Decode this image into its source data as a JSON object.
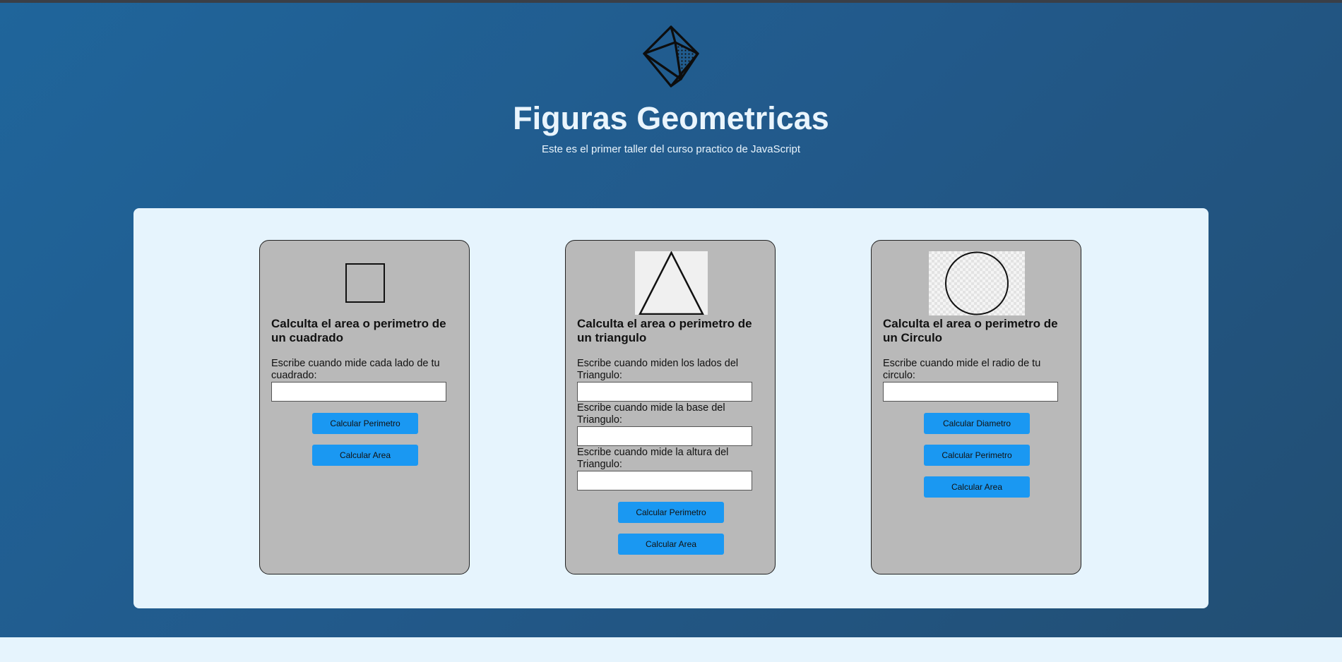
{
  "header": {
    "title": "Figuras Geometricas",
    "subtitle": "Este es el primer taller del curso practico de JavaScript",
    "icon": "octahedron-icon"
  },
  "colors": {
    "hero_gradient_start": "#1f659b",
    "hero_gradient_end": "#224e73",
    "panel_bg": "#e6f4fd",
    "card_bg": "#b9b9b9",
    "button_bg": "#1a98f2"
  },
  "cards": {
    "square": {
      "icon": "square-icon",
      "title": "Calculta el area o perimetro de un cuadrado",
      "fields": [
        {
          "label": "Escribe cuando mide cada lado de tu cuadrado:",
          "value": ""
        }
      ],
      "buttons": [
        "Calcular Perimetro",
        "Calcular Area"
      ]
    },
    "triangle": {
      "icon": "triangle-icon",
      "title": "Calculta el area o perimetro de un triangulo",
      "fields": [
        {
          "label": "Escribe cuando miden los lados del Triangulo:",
          "value": ""
        },
        {
          "label": "Escribe cuando mide la base del Triangulo:",
          "value": ""
        },
        {
          "label": "Escribe cuando mide la altura del Triangulo:",
          "value": ""
        }
      ],
      "buttons": [
        "Calcular Perimetro",
        "Calcular Area"
      ]
    },
    "circle": {
      "icon": "circle-icon",
      "title": "Calculta el area o perimetro de un Circulo",
      "fields": [
        {
          "label": "Escribe cuando mide el radio de tu circulo:",
          "value": ""
        }
      ],
      "buttons": [
        "Calcular Diametro",
        "Calcular Perimetro",
        "Calcular Area"
      ]
    }
  }
}
